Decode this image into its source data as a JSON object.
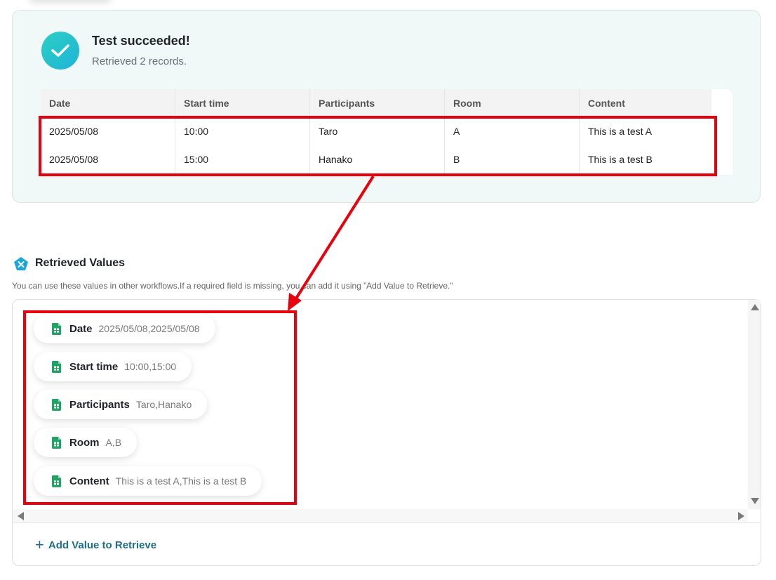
{
  "result": {
    "title": "Test succeeded!",
    "subtitle": "Retrieved 2 records.",
    "table": {
      "columns": [
        "Date",
        "Start time",
        "Participants",
        "Room",
        "Content"
      ],
      "rows": [
        [
          "2025/05/08",
          "10:00",
          "Taro",
          "A",
          "This is a test A"
        ],
        [
          "2025/05/08",
          "15:00",
          "Hanako",
          "B",
          "This is a test B"
        ]
      ]
    }
  },
  "retrieved": {
    "title": "Retrieved Values",
    "description": "You can use these values in other workflows.If a required field is missing, you can add it using ”Add Value to Retrieve.”",
    "items": [
      {
        "label": "Date",
        "value": "2025/05/08,2025/05/08",
        "icon": "spreadsheet-icon"
      },
      {
        "label": "Start time",
        "value": "10:00,15:00",
        "icon": "spreadsheet-icon"
      },
      {
        "label": "Participants",
        "value": "Taro,Hanako",
        "icon": "spreadsheet-icon"
      },
      {
        "label": "Room",
        "value": "A,B",
        "icon": "spreadsheet-icon"
      },
      {
        "label": "Content",
        "value": "This is a test A,This is a test B",
        "icon": "spreadsheet-icon"
      }
    ],
    "add_button": "Add Value to Retrieve"
  },
  "colors": {
    "highlight": "#e8000c",
    "success_gradient_start": "#2bd0c4",
    "success_gradient_end": "#1fb3d9",
    "link": "#1e6e86",
    "sheet_green": "#1fa463"
  }
}
